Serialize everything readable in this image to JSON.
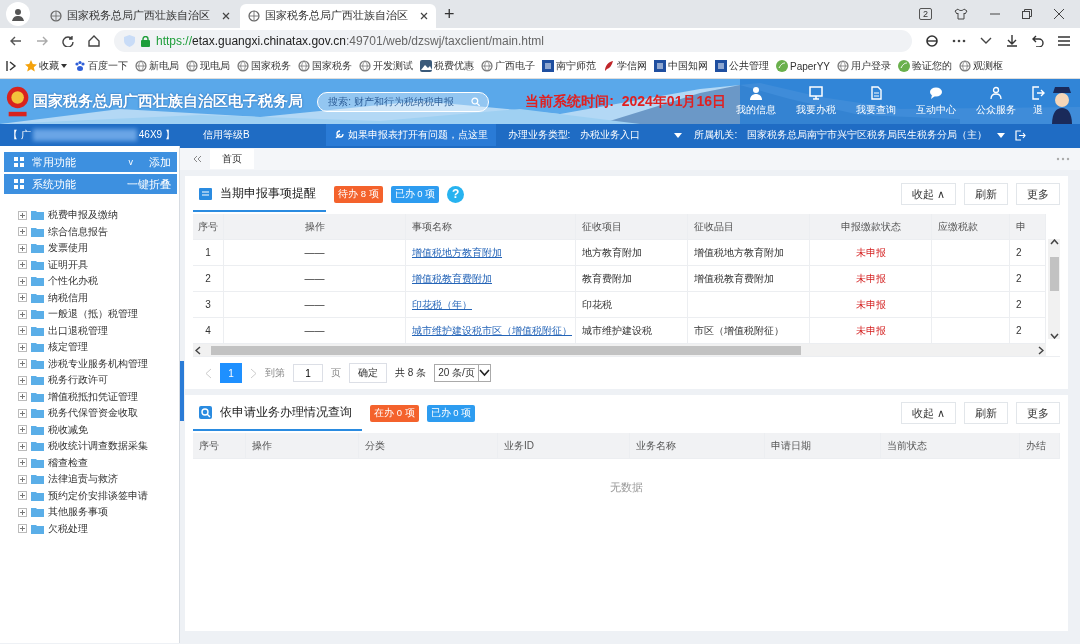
{
  "browser": {
    "tabs": [
      {
        "title": "国家税务总局广西壮族自治区",
        "selected": false
      },
      {
        "title": "国家税务总局广西壮族自治区",
        "selected": true
      }
    ],
    "new_tab": "+",
    "tab_count": "2",
    "url": {
      "scheme": "https://",
      "host": "etax.guangxi.chinatax.gov.cn",
      "path": ":49701/web/dzswj/taxclient/main.html"
    },
    "bookmarks": [
      {
        "label": "收藏",
        "kind": "star"
      },
      {
        "label": "百度一下",
        "kind": "paw"
      },
      {
        "label": "新电局",
        "kind": "globe"
      },
      {
        "label": "现电局",
        "kind": "globe"
      },
      {
        "label": "国家税务",
        "kind": "globe"
      },
      {
        "label": "国家税务",
        "kind": "globe"
      },
      {
        "label": "开发测试",
        "kind": "globe"
      },
      {
        "label": "税费优惠",
        "kind": "mountain"
      },
      {
        "label": "广西电子",
        "kind": "globe"
      },
      {
        "label": "南宁师范",
        "kind": "square"
      },
      {
        "label": "学信网",
        "kind": "feather"
      },
      {
        "label": "中国知网",
        "kind": "square"
      },
      {
        "label": "公共管理",
        "kind": "square"
      },
      {
        "label": "PaperYY",
        "kind": "leaf"
      },
      {
        "label": "用户登录",
        "kind": "globe"
      },
      {
        "label": "验证您的",
        "kind": "leaf"
      },
      {
        "label": "观测枢",
        "kind": "globe"
      }
    ]
  },
  "header": {
    "title": "国家税务总局广西壮族自治区电子税务局",
    "search_placeholder": "搜索: 财产和行为税纳税申报",
    "time_label": "当前系统时间:",
    "time_value": "2024年01月16日",
    "nav": [
      {
        "label": "我的信息",
        "kind": "user"
      },
      {
        "label": "我要办税",
        "kind": "monitor"
      },
      {
        "label": "我要查询",
        "kind": "doc"
      },
      {
        "label": "互动中心",
        "kind": "chat"
      },
      {
        "label": "公众服务",
        "kind": "people"
      },
      {
        "label": "退",
        "kind": "exit"
      }
    ]
  },
  "info_bar": {
    "taxpayer_start": "【 广",
    "taxpayer_end": "46X9 】",
    "credit": "信用等级B",
    "help": "如果申报表打开有问题，点这里",
    "business_type_label": "办理业务类型:",
    "business_type": "办税业务入口",
    "authority_label": "所属机关:",
    "authority": "国家税务总局南宁市兴宁区税务局民生税务分局（主）"
  },
  "sidebar": {
    "panels": [
      {
        "label": "常用功能",
        "caret": "v",
        "action": "添加"
      },
      {
        "label": "系统功能",
        "action": "一键折叠"
      }
    ],
    "tree": [
      {
        "label": "税费申报及缴纳",
        "expanded": false
      },
      {
        "label": "综合信息报告",
        "expanded": false
      },
      {
        "label": "发票使用",
        "expanded": false
      },
      {
        "label": "证明开具",
        "expanded": false
      },
      {
        "label": "个性化办税",
        "expanded": false
      },
      {
        "label": "纳税信用",
        "expanded": false
      },
      {
        "label": "一般退（抵）税管理",
        "expanded": false
      },
      {
        "label": "出口退税管理",
        "expanded": false
      },
      {
        "label": "核定管理",
        "expanded": false
      },
      {
        "label": "涉税专业服务机构管理",
        "expanded": false
      },
      {
        "label": "税务行政许可",
        "expanded": false
      },
      {
        "label": "增值税抵扣凭证管理",
        "expanded": false
      },
      {
        "label": "税务代保管资金收取",
        "expanded": false
      },
      {
        "label": "税收减免",
        "expanded": false
      },
      {
        "label": "税收统计调查数据采集",
        "expanded": false
      },
      {
        "label": "稽查检查",
        "expanded": false
      },
      {
        "label": "法律追责与救济",
        "expanded": false
      },
      {
        "label": "预约定价安排谈签申请",
        "expanded": false
      },
      {
        "label": "其他服务事项",
        "expanded": false
      },
      {
        "label": "欠税处理",
        "expanded": false
      }
    ]
  },
  "page_tabs": [
    {
      "label": "首页",
      "selected": true
    }
  ],
  "sections": [
    {
      "title": "当期申报事项提醒",
      "kind": "reminder",
      "badges": [
        {
          "label": "待办 8 项",
          "kind": "pending"
        },
        {
          "label": "已办 0 项",
          "kind": "done"
        }
      ],
      "help": "?",
      "buttons": [
        "收起 ∧",
        "刷新",
        "更多"
      ],
      "table": {
        "columns": [
          "序号",
          "操作",
          "事项名称",
          "征收项目",
          "征收品目",
          "申报缴款状态",
          "应缴税款",
          "申"
        ],
        "rows": [
          [
            "1",
            "——",
            "增值税地方教育附加",
            "地方教育附加",
            "增值税地方教育附加",
            "未申报",
            "",
            "2"
          ],
          [
            "2",
            "——",
            "增值税教育费附加",
            "教育费附加",
            "增值税教育费附加",
            "未申报",
            "",
            "2"
          ],
          [
            "3",
            "——",
            "印花税（年）",
            "印花税",
            "",
            "未申报",
            "",
            "2"
          ],
          [
            "4",
            "——",
            "城市维护建设税市区（增值税附征）",
            "城市维护建设税",
            "市区（增值税附征）",
            "未申报",
            "",
            "2"
          ]
        ]
      },
      "pagination": {
        "pages": [
          {
            "label": "1",
            "selected": true
          }
        ],
        "goto_label": "到第",
        "goto_value": "1",
        "page_unit": "页",
        "confirm": "确定",
        "total": "共 8 条",
        "page_size": "20 条/页"
      }
    },
    {
      "title": "依申请业务办理情况查询",
      "kind": "query",
      "badges": [
        {
          "label": "在办 0 项",
          "kind": "pending"
        },
        {
          "label": "已办 0 项",
          "kind": "done"
        }
      ],
      "buttons": [
        "收起 ∧",
        "刷新",
        "更多"
      ],
      "table": {
        "columns": [
          "序号",
          "操作",
          "分类",
          "业务ID",
          "业务名称",
          "申请日期",
          "当前状态",
          "办结"
        ],
        "empty_text": "无数据"
      }
    }
  ]
}
